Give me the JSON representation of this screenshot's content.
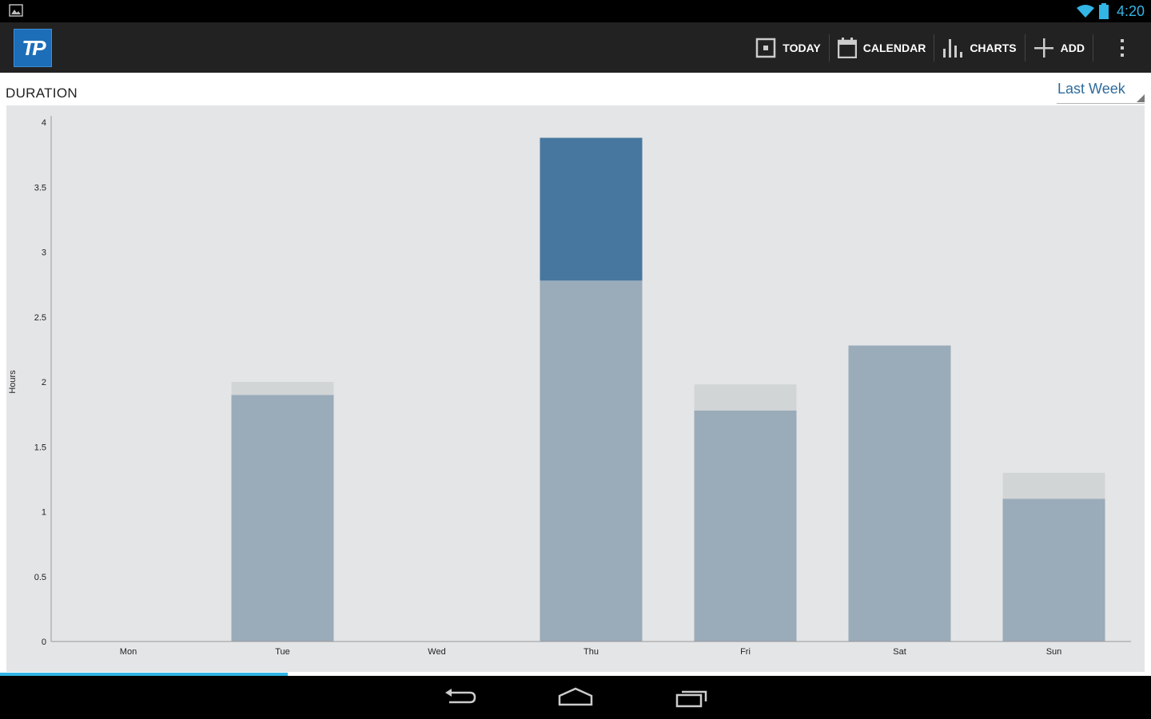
{
  "status_bar": {
    "time": "4:20",
    "left_icon": "image-notification-icon",
    "right_icons": [
      "wifi-icon",
      "battery-icon"
    ]
  },
  "action_bar": {
    "logo_text": "TP",
    "actions": [
      {
        "label": "TODAY",
        "icon": "today-icon"
      },
      {
        "label": "CALENDAR",
        "icon": "calendar-icon"
      },
      {
        "label": "CHARTS",
        "icon": "charts-icon"
      },
      {
        "label": "ADD",
        "icon": "plus-icon"
      }
    ],
    "overflow_icon": "overflow-menu-icon"
  },
  "chart_header": {
    "title": "DURATION",
    "range_selected": "Last Week"
  },
  "colors": {
    "completed": "#9aabb9",
    "planned_extra": "#d2d5d6",
    "highlight": "#47779f",
    "chart_bg": "#e4e5e7",
    "accent": "#33b5e5"
  },
  "chart_data": {
    "type": "bar",
    "stacked": true,
    "categories": [
      "Mon",
      "Tue",
      "Wed",
      "Thu",
      "Fri",
      "Sat",
      "Sun"
    ],
    "series": [
      {
        "values": [
          0,
          1.9,
          0,
          2.78,
          1.78,
          2.28,
          1.1
        ]
      },
      {
        "values": [
          0,
          0.1,
          0,
          0,
          0.2,
          0,
          0.2
        ]
      },
      {
        "values": [
          0,
          0,
          0,
          1.1,
          0,
          0,
          0
        ]
      }
    ],
    "ylabel": "Hours",
    "xlabel": "",
    "ylim": [
      0,
      4
    ],
    "yticks": [
      "0",
      "0.5",
      "1",
      "1.5",
      "2",
      "2.5",
      "3",
      "3.5",
      "4"
    ],
    "grid": false
  },
  "progress": {
    "fraction": 0.25
  },
  "nav_bar": {
    "buttons": [
      "back-icon",
      "home-icon",
      "recent-apps-icon"
    ]
  }
}
